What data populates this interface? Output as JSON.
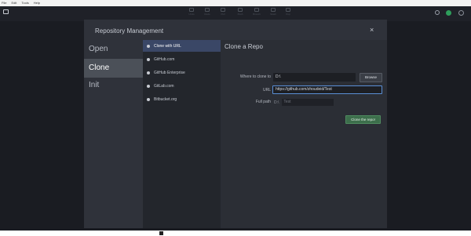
{
  "os_menu": [
    "File",
    "Edit",
    "Tools",
    "Help"
  ],
  "toolbar": {
    "buttons": [
      "Undo",
      "Redo",
      "Pull",
      "Push",
      "Branch",
      "Stash",
      "Pop"
    ]
  },
  "modal": {
    "title": "Repository Management",
    "close": "×",
    "modes": [
      "Open",
      "Clone",
      "Init"
    ],
    "sources": [
      "Clone with URL",
      "GitHub.com",
      "GitHub Enterprise",
      "GitLab.com",
      "Bitbucket.org"
    ],
    "form": {
      "title": "Clone a Repo",
      "where_label": "Where to clone to",
      "where_value": "D:\\",
      "browse_label": "Browse",
      "url_label": "URL",
      "url_value": "https://github.com/zhoudeid/Test",
      "fullpath_label": "Full path",
      "fullpath_prefix": "D:\\",
      "fullpath_value": "Test",
      "clone_button": "Clone the repo!"
    }
  },
  "colors": {
    "active_source": "#3a4766",
    "clone_button": "#3c6e4b",
    "url_focus": "#5a8fd6"
  }
}
